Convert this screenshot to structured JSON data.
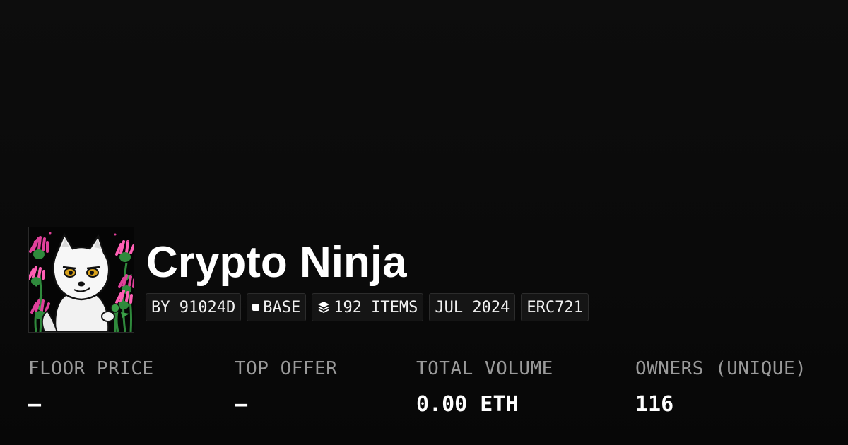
{
  "collection": {
    "name": "Crypto Ninja",
    "avatar_icon": "white-wolf-avatar",
    "badges": {
      "creator": "BY 91024D",
      "chain": "BASE",
      "chain_icon": "square-icon",
      "items": "192 ITEMS",
      "items_icon": "layers-icon",
      "date": "JUL 2024",
      "standard": "ERC721"
    }
  },
  "stats": {
    "floor_price": {
      "label": "FLOOR PRICE",
      "value": "—"
    },
    "top_offer": {
      "label": "TOP OFFER",
      "value": "—"
    },
    "total_volume": {
      "label": "TOTAL VOLUME",
      "value": "0.00 ETH"
    },
    "owners": {
      "label": "OWNERS (UNIQUE)",
      "value": "116"
    }
  },
  "colors": {
    "background": "#0b0b0b",
    "text": "#ffffff",
    "muted": "#9a9a9a",
    "badge_bg": "#151515",
    "flower_accent": "#e0409a"
  }
}
